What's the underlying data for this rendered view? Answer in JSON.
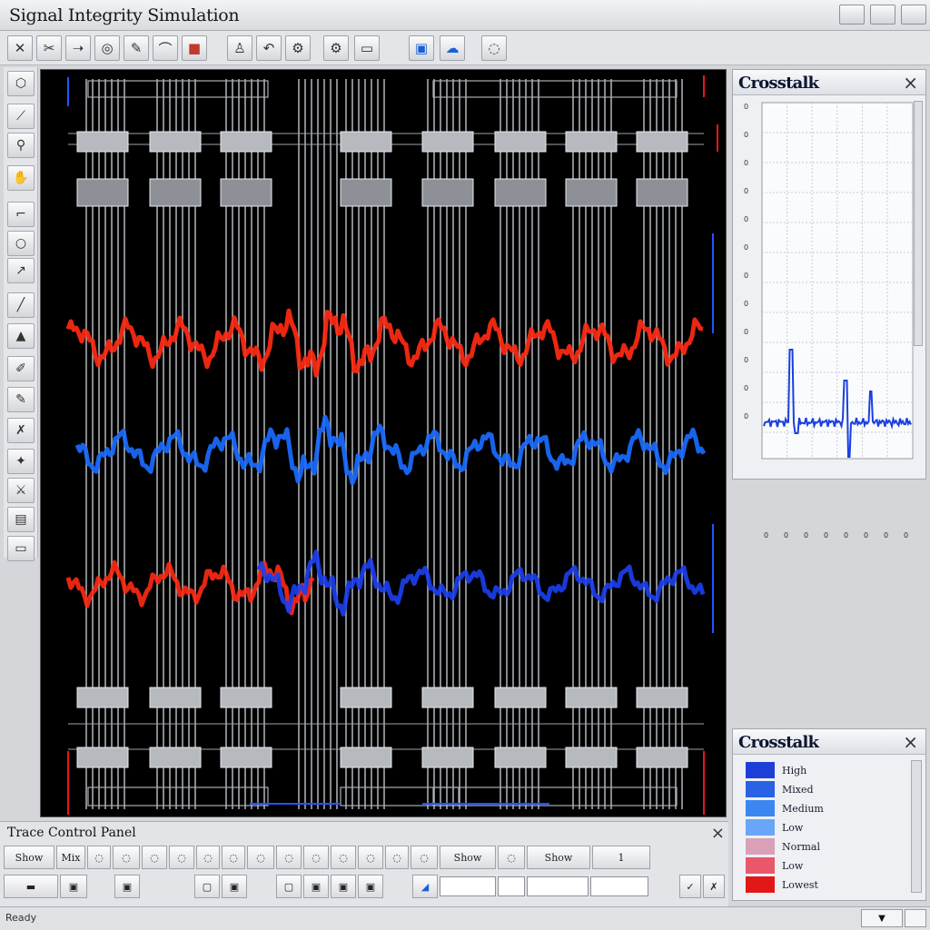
{
  "window": {
    "title": "Signal Integrity Simulation",
    "accent_red": "#ff2a14",
    "accent_blue": "#1a6bff"
  },
  "toolbar": {
    "buttons": [
      "select-icon",
      "cut-icon",
      "wire-icon",
      "measure-icon",
      "probe-icon",
      "curve-icon",
      "stop-icon",
      "person-icon",
      "undo-icon",
      "gear-icon",
      "grid-icon",
      "save-icon",
      "cloud-icon",
      "layers-icon"
    ]
  },
  "left_tools": [
    "node-icon",
    "zoom-icon",
    "figure-icon",
    "hand-icon",
    "connector-icon",
    "circle-icon",
    "arrow-icon",
    "line-icon",
    "triangle-icon",
    "brush-icon",
    "pencil-icon",
    "cross-icon",
    "pin-icon",
    "split-icon",
    "display-icon",
    "box-icon"
  ],
  "crosstalk_plot": {
    "title": "Crosstalk",
    "close": "×",
    "yticks": [
      "0",
      "0",
      "0",
      "0",
      "0",
      "0",
      "0",
      "0",
      "0",
      "0",
      "0",
      "0"
    ],
    "xticks": [
      "0",
      "0",
      "0",
      "0",
      "0",
      "0",
      "0",
      "0"
    ]
  },
  "crosstalk_legend": {
    "title": "Crosstalk",
    "close": "×",
    "items": [
      {
        "label": "High",
        "color": "#1d3fd8"
      },
      {
        "label": "Mixed",
        "color": "#2a62e6"
      },
      {
        "label": "Medium",
        "color": "#3c86f2"
      },
      {
        "label": "Low",
        "color": "#6aa6f8"
      },
      {
        "label": "Normal",
        "color": "#d9a0b8"
      },
      {
        "label": "Low",
        "color": "#e8586a"
      },
      {
        "label": "Lowest",
        "color": "#e21818"
      }
    ]
  },
  "trace": {
    "title": "Trace Control Panel",
    "close": "×",
    "labels": [
      "Show",
      "Mix",
      "Show",
      "Show"
    ],
    "field_value": "1"
  },
  "status": {
    "text": "Ready"
  }
}
